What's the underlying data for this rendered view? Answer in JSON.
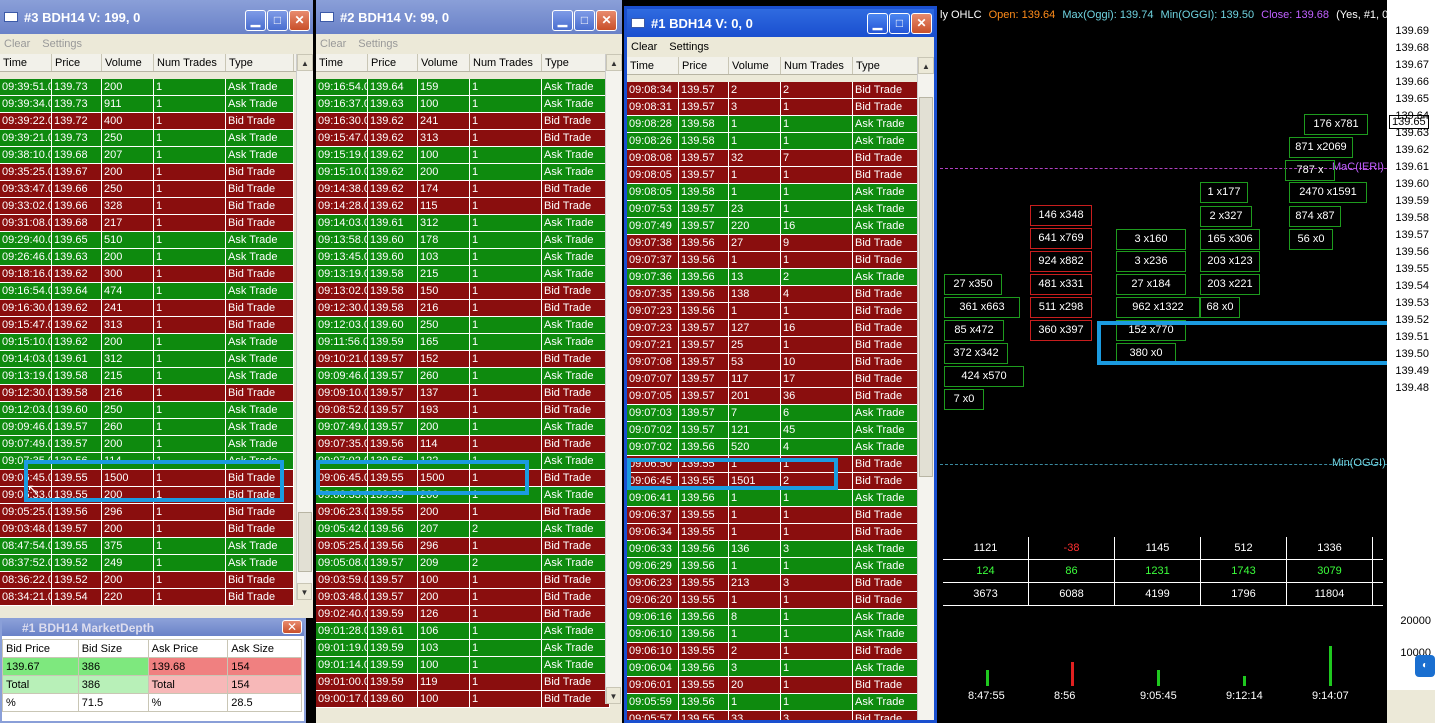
{
  "columns": [
    "Time",
    "Price",
    "Volume",
    "Num Trades",
    "Type"
  ],
  "menu": {
    "clear": "Clear",
    "settings": "Settings"
  },
  "win3": {
    "title": "#3 BDH14  V: 199, 0",
    "rows": [
      [
        "09:39:51.0",
        "139.73",
        "200",
        "1",
        "Ask Trade"
      ],
      [
        "09:39:34.0",
        "139.73",
        "911",
        "1",
        "Ask Trade"
      ],
      [
        "09:39:22.0",
        "139.72",
        "400",
        "1",
        "Bid Trade"
      ],
      [
        "09:39:21.0",
        "139.73",
        "250",
        "1",
        "Ask Trade"
      ],
      [
        "09:38:10.0",
        "139.68",
        "207",
        "1",
        "Ask Trade"
      ],
      [
        "09:35:25.0",
        "139.67",
        "200",
        "1",
        "Bid Trade"
      ],
      [
        "09:33:47.0",
        "139.66",
        "250",
        "1",
        "Bid Trade"
      ],
      [
        "09:33:02.0",
        "139.66",
        "328",
        "1",
        "Bid Trade"
      ],
      [
        "09:31:08.0",
        "139.68",
        "217",
        "1",
        "Bid Trade"
      ],
      [
        "09:29:40.0",
        "139.65",
        "510",
        "1",
        "Ask Trade"
      ],
      [
        "09:26:46.0",
        "139.63",
        "200",
        "1",
        "Ask Trade"
      ],
      [
        "09:18:16.0",
        "139.62",
        "300",
        "1",
        "Bid Trade"
      ],
      [
        "09:16:54.0",
        "139.64",
        "474",
        "1",
        "Ask Trade"
      ],
      [
        "09:16:30.0",
        "139.62",
        "241",
        "1",
        "Bid Trade"
      ],
      [
        "09:15:47.0",
        "139.62",
        "313",
        "1",
        "Bid Trade"
      ],
      [
        "09:15:10.0",
        "139.62",
        "200",
        "1",
        "Ask Trade"
      ],
      [
        "09:14:03.0",
        "139.61",
        "312",
        "1",
        "Ask Trade"
      ],
      [
        "09:13:19.0",
        "139.58",
        "215",
        "1",
        "Ask Trade"
      ],
      [
        "09:12:30.0",
        "139.58",
        "216",
        "1",
        "Bid Trade"
      ],
      [
        "09:12:03.0",
        "139.60",
        "250",
        "1",
        "Ask Trade"
      ],
      [
        "09:09:46.0",
        "139.57",
        "260",
        "1",
        "Ask Trade"
      ],
      [
        "09:07:49.0",
        "139.57",
        "200",
        "1",
        "Ask Trade"
      ],
      [
        "09:07:35.0",
        "139.56",
        "114",
        "1",
        "Ask Trade"
      ],
      [
        "09:06:45.0",
        "139.55",
        "1500",
        "1",
        "Bid Trade"
      ],
      [
        "09:06:33.0",
        "139.55",
        "200",
        "1",
        "Bid Trade"
      ],
      [
        "09:05:25.0",
        "139.56",
        "296",
        "1",
        "Bid Trade"
      ],
      [
        "09:03:48.0",
        "139.57",
        "200",
        "1",
        "Bid Trade"
      ],
      [
        "08:47:54.0",
        "139.55",
        "375",
        "1",
        "Ask Trade"
      ],
      [
        "08:37:52.0",
        "139.52",
        "249",
        "1",
        "Ask Trade"
      ],
      [
        "08:36:22.0",
        "139.52",
        "200",
        "1",
        "Bid Trade"
      ],
      [
        "08:34:21.0",
        "139.54",
        "220",
        "1",
        "Bid Trade"
      ]
    ]
  },
  "win2": {
    "title": "#2 BDH14  V: 99, 0",
    "rows": [
      [
        "09:16:54.0",
        "139.64",
        "159",
        "1",
        "Ask Trade"
      ],
      [
        "09:16:37.0",
        "139.63",
        "100",
        "1",
        "Ask Trade"
      ],
      [
        "09:16:30.0",
        "139.62",
        "241",
        "1",
        "Bid Trade"
      ],
      [
        "09:15:47.0",
        "139.62",
        "313",
        "1",
        "Bid Trade"
      ],
      [
        "09:15:19.0",
        "139.62",
        "100",
        "1",
        "Ask Trade"
      ],
      [
        "09:15:10.0",
        "139.62",
        "200",
        "1",
        "Ask Trade"
      ],
      [
        "09:14:38.0",
        "139.62",
        "174",
        "1",
        "Bid Trade"
      ],
      [
        "09:14:28.0",
        "139.62",
        "115",
        "1",
        "Bid Trade"
      ],
      [
        "09:14:03.0",
        "139.61",
        "312",
        "1",
        "Ask Trade"
      ],
      [
        "09:13:58.0",
        "139.60",
        "178",
        "1",
        "Ask Trade"
      ],
      [
        "09:13:45.0",
        "139.60",
        "103",
        "1",
        "Ask Trade"
      ],
      [
        "09:13:19.0",
        "139.58",
        "215",
        "1",
        "Ask Trade"
      ],
      [
        "09:13:02.0",
        "139.58",
        "150",
        "1",
        "Bid Trade"
      ],
      [
        "09:12:30.0",
        "139.58",
        "216",
        "1",
        "Bid Trade"
      ],
      [
        "09:12:03.0",
        "139.60",
        "250",
        "1",
        "Ask Trade"
      ],
      [
        "09:11:56.0",
        "139.59",
        "165",
        "1",
        "Ask Trade"
      ],
      [
        "09:10:21.0",
        "139.57",
        "152",
        "1",
        "Bid Trade"
      ],
      [
        "09:09:46.0",
        "139.57",
        "260",
        "1",
        "Ask Trade"
      ],
      [
        "09:09:10.0",
        "139.57",
        "137",
        "1",
        "Bid Trade"
      ],
      [
        "09:08:52.0",
        "139.57",
        "193",
        "1",
        "Bid Trade"
      ],
      [
        "09:07:49.0",
        "139.57",
        "200",
        "1",
        "Ask Trade"
      ],
      [
        "09:07:35.0",
        "139.56",
        "114",
        "1",
        "Bid Trade"
      ],
      [
        "09:07:02.0",
        "139.56",
        "122",
        "1",
        "Ask Trade"
      ],
      [
        "09:06:45.0",
        "139.55",
        "1500",
        "1",
        "Bid Trade"
      ],
      [
        "09:06:33.0",
        "139.55",
        "200",
        "1",
        "Ask Trade"
      ],
      [
        "09:06:23.0",
        "139.55",
        "200",
        "1",
        "Bid Trade"
      ],
      [
        "09:05:42.0",
        "139.56",
        "207",
        "2",
        "Ask Trade"
      ],
      [
        "09:05:25.0",
        "139.56",
        "296",
        "1",
        "Bid Trade"
      ],
      [
        "09:05:08.0",
        "139.57",
        "209",
        "2",
        "Ask Trade"
      ],
      [
        "09:03:59.0",
        "139.57",
        "100",
        "1",
        "Bid Trade"
      ],
      [
        "09:03:48.0",
        "139.57",
        "200",
        "1",
        "Bid Trade"
      ],
      [
        "09:02:40.0",
        "139.59",
        "126",
        "1",
        "Bid Trade"
      ],
      [
        "09:01:28.0",
        "139.61",
        "106",
        "1",
        "Ask Trade"
      ],
      [
        "09:01:19.0",
        "139.59",
        "103",
        "1",
        "Ask Trade"
      ],
      [
        "09:01:14.0",
        "139.59",
        "100",
        "1",
        "Ask Trade"
      ],
      [
        "09:01:00.0",
        "139.59",
        "119",
        "1",
        "Bid Trade"
      ],
      [
        "09:00:17.0",
        "139.60",
        "100",
        "1",
        "Bid Trade"
      ]
    ]
  },
  "win1": {
    "title": "#1 BDH14  V: 0, 0",
    "rows": [
      [
        "09:08:34",
        "139.57",
        "2",
        "2",
        "Bid Trade"
      ],
      [
        "09:08:31",
        "139.57",
        "3",
        "1",
        "Bid Trade"
      ],
      [
        "09:08:28",
        "139.58",
        "1",
        "1",
        "Ask Trade"
      ],
      [
        "09:08:26",
        "139.58",
        "1",
        "1",
        "Ask Trade"
      ],
      [
        "09:08:08",
        "139.57",
        "32",
        "7",
        "Bid Trade"
      ],
      [
        "09:08:05",
        "139.57",
        "1",
        "1",
        "Bid Trade"
      ],
      [
        "09:08:05",
        "139.58",
        "1",
        "1",
        "Ask Trade"
      ],
      [
        "09:07:53",
        "139.57",
        "23",
        "1",
        "Ask Trade"
      ],
      [
        "09:07:49",
        "139.57",
        "220",
        "16",
        "Ask Trade"
      ],
      [
        "09:07:38",
        "139.56",
        "27",
        "9",
        "Bid Trade"
      ],
      [
        "09:07:37",
        "139.56",
        "1",
        "1",
        "Bid Trade"
      ],
      [
        "09:07:36",
        "139.56",
        "13",
        "2",
        "Ask Trade"
      ],
      [
        "09:07:35",
        "139.56",
        "138",
        "4",
        "Bid Trade"
      ],
      [
        "09:07:23",
        "139.56",
        "1",
        "1",
        "Bid Trade"
      ],
      [
        "09:07:23",
        "139.57",
        "127",
        "16",
        "Bid Trade"
      ],
      [
        "09:07:21",
        "139.57",
        "25",
        "1",
        "Bid Trade"
      ],
      [
        "09:07:08",
        "139.57",
        "53",
        "10",
        "Bid Trade"
      ],
      [
        "09:07:07",
        "139.57",
        "117",
        "17",
        "Bid Trade"
      ],
      [
        "09:07:05",
        "139.57",
        "201",
        "36",
        "Bid Trade"
      ],
      [
        "09:07:03",
        "139.57",
        "7",
        "6",
        "Ask Trade"
      ],
      [
        "09:07:02",
        "139.57",
        "121",
        "45",
        "Ask Trade"
      ],
      [
        "09:07:02",
        "139.56",
        "520",
        "4",
        "Ask Trade"
      ],
      [
        "09:06:50",
        "139.55",
        "1",
        "1",
        "Bid Trade"
      ],
      [
        "09:06:45",
        "139.55",
        "1501",
        "2",
        "Bid Trade"
      ],
      [
        "09:06:41",
        "139.56",
        "1",
        "1",
        "Ask Trade"
      ],
      [
        "09:06:37",
        "139.55",
        "1",
        "1",
        "Bid Trade"
      ],
      [
        "09:06:34",
        "139.55",
        "1",
        "1",
        "Bid Trade"
      ],
      [
        "09:06:33",
        "139.56",
        "136",
        "3",
        "Ask Trade"
      ],
      [
        "09:06:29",
        "139.56",
        "1",
        "1",
        "Ask Trade"
      ],
      [
        "09:06:23",
        "139.55",
        "213",
        "3",
        "Bid Trade"
      ],
      [
        "09:06:20",
        "139.55",
        "1",
        "1",
        "Bid Trade"
      ],
      [
        "09:06:16",
        "139.56",
        "8",
        "1",
        "Ask Trade"
      ],
      [
        "09:06:10",
        "139.56",
        "1",
        "1",
        "Ask Trade"
      ],
      [
        "09:06:10",
        "139.55",
        "2",
        "1",
        "Bid Trade"
      ],
      [
        "09:06:04",
        "139.56",
        "3",
        "1",
        "Ask Trade"
      ],
      [
        "09:06:01",
        "139.55",
        "20",
        "1",
        "Bid Trade"
      ],
      [
        "09:05:59",
        "139.56",
        "1",
        "1",
        "Ask Trade"
      ],
      [
        "09:05:57",
        "139.55",
        "33",
        "3",
        "Bid Trade"
      ]
    ]
  },
  "market_depth": {
    "title": "#1 BDH14 MarketDepth",
    "headers": [
      "Bid Price",
      "Bid Size",
      "Ask Price",
      "Ask Size"
    ],
    "rows": [
      [
        "139.67",
        "386",
        "139.68",
        "154"
      ],
      [
        "Total",
        "386",
        "Total",
        "154"
      ],
      [
        "%",
        "71.5",
        "%",
        "28.5"
      ]
    ]
  },
  "chart": {
    "header_prefix": "ly OHLC",
    "open": "Open: 139.64",
    "max": "Max(Oggi): 139.74",
    "min": "Min(OGGI): 139.50",
    "close": "Close: 139.68",
    "extra": "(Yes, #1, 0,",
    "price_ticks": [
      "139.69",
      "139.68",
      "139.67",
      "139.66",
      "139.65",
      "139.64",
      "139.63",
      "139.62",
      "139.61",
      "139.60",
      "139.59",
      "139.58",
      "139.57",
      "139.56",
      "139.55",
      "139.54",
      "139.53",
      "139.52",
      "139.51",
      "139.50",
      "139.49",
      "139.48"
    ],
    "current_price": "139.65",
    "maxieri_label": "MaC(IERI)",
    "min_label": "Min(OGGI)",
    "footprint": [
      {
        "t": "176 x781",
        "c": "g"
      },
      {
        "t": "871 x2069",
        "c": "g"
      },
      {
        "t": "787 x",
        "c": "g"
      },
      {
        "t": "2470 x1591",
        "c": "g"
      },
      {
        "t": "874 x87",
        "c": "g"
      },
      {
        "t": "56 x0",
        "c": "g"
      },
      {
        "t": "1 x177",
        "c": "g"
      },
      {
        "t": "2 x327",
        "c": "g"
      },
      {
        "t": "165 x306",
        "c": "g"
      },
      {
        "t": "203 x123",
        "c": "g"
      },
      {
        "t": "203 x221",
        "c": "g"
      },
      {
        "t": "68 x0",
        "c": "g"
      },
      {
        "t": "146 x348",
        "c": "r"
      },
      {
        "t": "641 x769",
        "c": "r"
      },
      {
        "t": "924 x882",
        "c": "r"
      },
      {
        "t": "481 x331",
        "c": "r"
      },
      {
        "t": "511 x298",
        "c": "r"
      },
      {
        "t": "360 x397",
        "c": "r"
      },
      {
        "t": "3 x160",
        "c": "g"
      },
      {
        "t": "3 x236",
        "c": "g"
      },
      {
        "t": "27 x184",
        "c": "g"
      },
      {
        "t": "962 x1322",
        "c": "g"
      },
      {
        "t": "152 x770",
        "c": "g"
      },
      {
        "t": "380 x0",
        "c": "g"
      },
      {
        "t": "27 x350",
        "c": "g"
      },
      {
        "t": "361 x663",
        "c": "g"
      },
      {
        "t": "85 x472",
        "c": "g"
      },
      {
        "t": "372 x342",
        "c": "g"
      },
      {
        "t": "424 x570",
        "c": "g"
      },
      {
        "t": "7 x0",
        "c": "g"
      }
    ],
    "summary": [
      [
        "1121",
        "-38",
        "1145",
        "512",
        "1336"
      ],
      [
        "124",
        "86",
        "1231",
        "1743",
        "3079"
      ],
      [
        "3673",
        "6088",
        "4199",
        "1796",
        "11804"
      ]
    ],
    "volume_ticks": [
      "20000",
      "10000"
    ],
    "time_labels": [
      "8:47:55",
      "8:56",
      "9:05:45",
      "9:12:14",
      "9:14:07"
    ]
  }
}
